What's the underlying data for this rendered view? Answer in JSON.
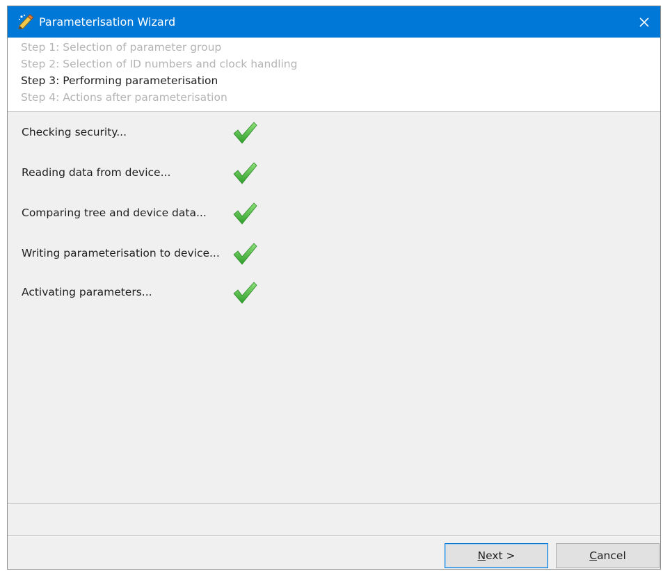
{
  "window": {
    "title": "Parameterisation Wizard",
    "icon": "wizard-pencil-icon",
    "accent_color": "#0078d7"
  },
  "steps": [
    {
      "label": "Step 1: Selection of parameter group",
      "state": "inactive"
    },
    {
      "label": "Step 2: Selection of ID numbers and clock handling",
      "state": "inactive"
    },
    {
      "label": "Step 3: Performing parameterisation",
      "state": "active"
    },
    {
      "label": "Step 4: Actions after parameterisation",
      "state": "inactive"
    }
  ],
  "tasks": [
    {
      "label": "Checking security...",
      "status": "done",
      "status_icon": "green-checkmark-icon"
    },
    {
      "label": "Reading data from device...",
      "status": "done",
      "status_icon": "green-checkmark-icon"
    },
    {
      "label": "Comparing tree and device data...",
      "status": "done",
      "status_icon": "green-checkmark-icon"
    },
    {
      "label": "Writing parameterisation to device...",
      "status": "done",
      "status_icon": "green-checkmark-icon"
    },
    {
      "label": "Activating parameters...",
      "status": "done",
      "status_icon": "green-checkmark-icon"
    }
  ],
  "buttons": {
    "next": {
      "mnemonic": "N",
      "rest": "ext >"
    },
    "cancel": {
      "mnemonic": "C",
      "rest": "ancel"
    }
  }
}
